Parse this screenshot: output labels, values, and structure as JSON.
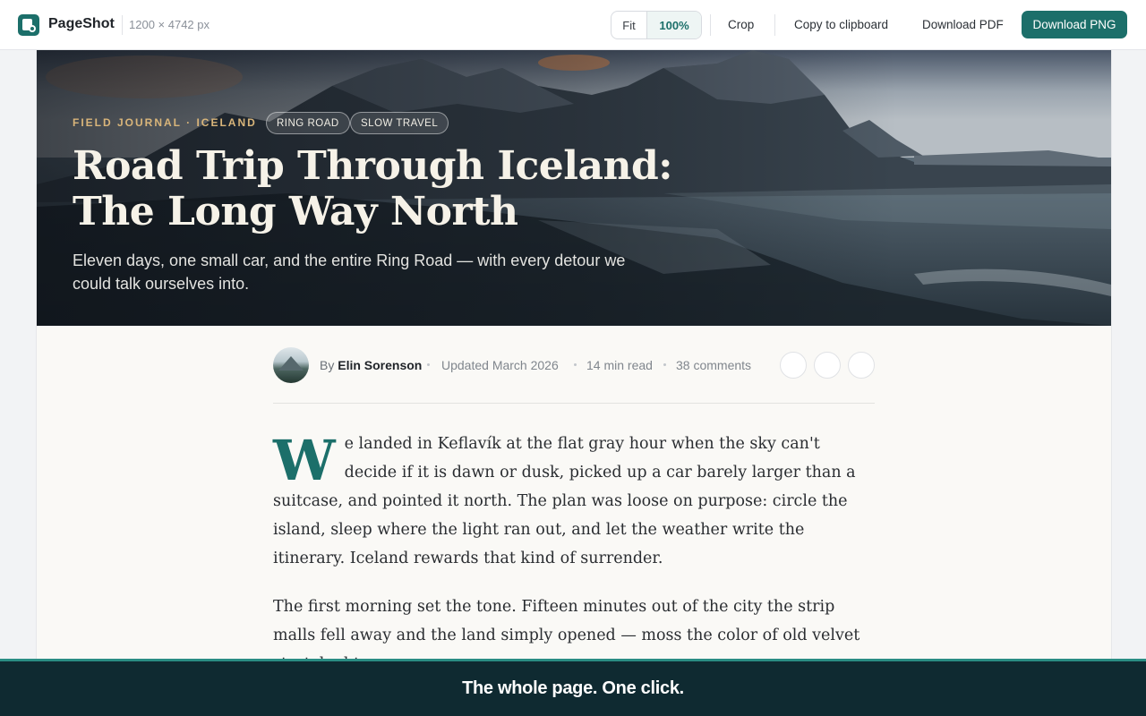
{
  "app": {
    "name": "PageShot",
    "dimensions": "1200 × 4742 px"
  },
  "toolbar": {
    "fit_label": "Fit",
    "zoom_label": "100%",
    "crop_label": "Crop",
    "copy_label": "Copy to clipboard",
    "pdf_label": "Download PDF",
    "png_label": "Download PNG"
  },
  "article": {
    "kicker": "FIELD JOURNAL · ICELAND",
    "tags": [
      "RING ROAD",
      "SLOW TRAVEL"
    ],
    "title": "Road Trip Through Iceland: The Long Way North",
    "subtitle": "Eleven days, one small car, and the entire Ring Road — with every detour we could talk ourselves into.",
    "byline_prefix": "By",
    "author": "Elin Sorenson",
    "updated": "Updated March 2026",
    "read_time": "14 min read",
    "comments": "38 comments",
    "dropcap": "W",
    "paragraph_1": "e landed in Keflavík at the flat gray hour when the sky can't decide if it is dawn or dusk, picked up a car barely larger than a suitcase, and pointed it north. The plan was loose on purpose: circle the island, sleep where the light ran out, and let the weather write the itinerary. Iceland rewards that kind of surrender.",
    "paragraph_2": "The first morning set the tone. Fifteen minutes out of the city the strip malls fell away and the land simply opened — moss the color of old velvet stretched to a"
  },
  "banner": {
    "text": "The whole page. One click."
  },
  "colors": {
    "accent": "#1c6f6a",
    "banner_bg": "#0f2a31",
    "kicker": "#d9b57a"
  }
}
